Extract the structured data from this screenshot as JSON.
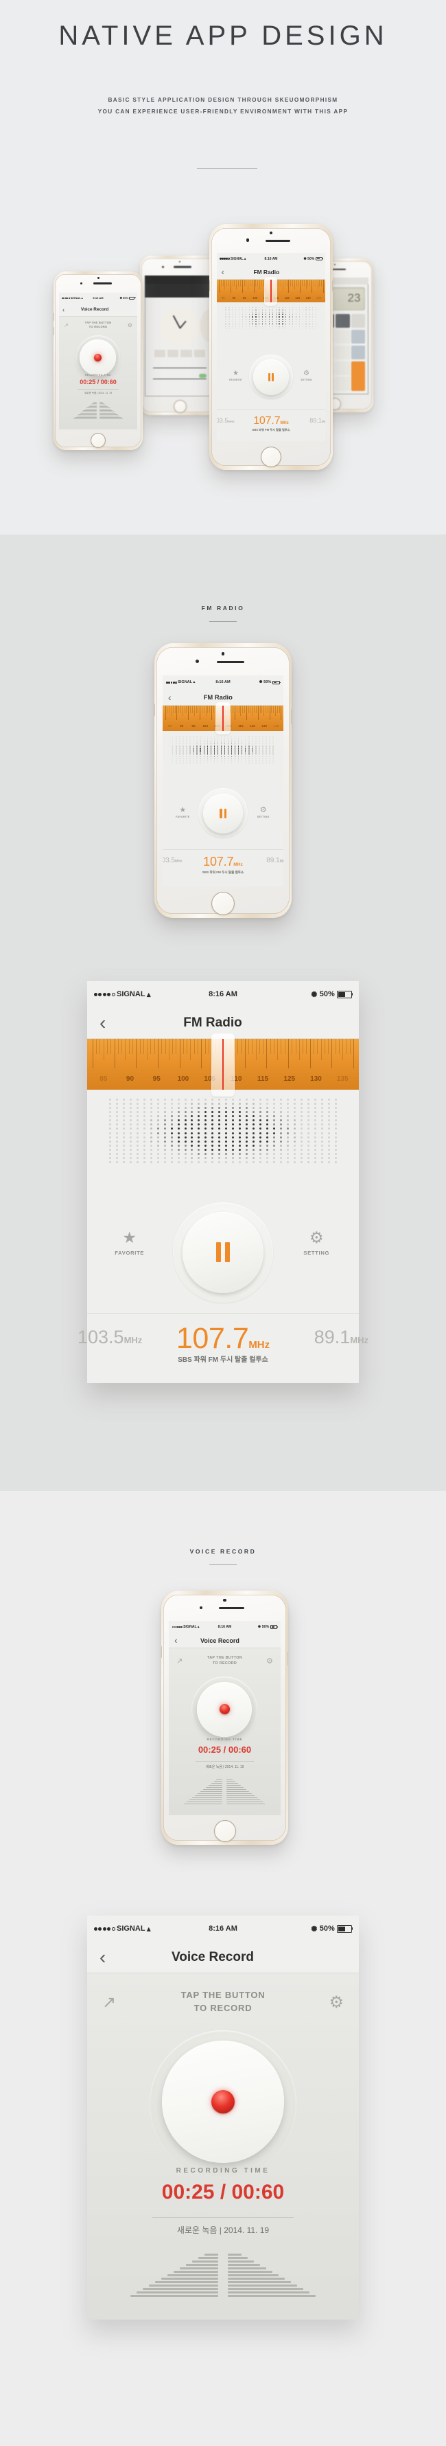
{
  "header": {
    "title": "NATIVE APP DESIGN",
    "subtitle_line1": "BASIC STYLE APPLICATION DESIGN THROUGH SKEUOMORPHISM",
    "subtitle_line2": "YOU CAN EXPERIENCE USER-FRIENDLY ENVIRONMENT WITH THIS APP"
  },
  "sections": {
    "fm_label": "FM RADIO",
    "voice_label": "VOICE RECORD"
  },
  "statusbar": {
    "carrier": "SIGNAL",
    "time": "8:16 AM",
    "battery": "50%",
    "wifi_icon": "wifi-icon",
    "bluetooth_icon": "bluetooth-icon",
    "battery_icon": "battery-icon",
    "signal_dots_icon": "signal-dots-icon"
  },
  "fm_radio": {
    "nav": {
      "title": "FM Radio",
      "back_icon": "back-chevron-icon",
      "menu_icon": "list-menu-icon"
    },
    "tuner": {
      "ticks": [
        "85",
        "90",
        "95",
        "100",
        "105",
        "110",
        "115",
        "125",
        "130",
        "135"
      ],
      "needle_value": "107.7",
      "needle_icon": "tuner-needle-icon"
    },
    "speaker_icon": "speaker-grille-icon",
    "play_button": {
      "icon": "pause-icon",
      "state": "playing"
    },
    "favorite": {
      "label": "FAVORITE",
      "icon": "star-icon"
    },
    "setting": {
      "label": "SETTING",
      "icon": "gear-icon"
    },
    "frequency": {
      "prev": "103.5",
      "prev_unit": "MHz",
      "current": "107.7",
      "current_unit": "MHz",
      "next": "89.1",
      "next_unit": "MHz"
    },
    "station_name": "SBS 파워 FM 두시 탈출 컬투쇼",
    "accent_color": "#ee8a29"
  },
  "voice_record": {
    "nav": {
      "title": "Voice Record",
      "back_icon": "back-chevron-icon",
      "menu_icon": "list-menu-icon"
    },
    "hint_line1": "TAP THE BUTTON",
    "hint_line2": "TO RECORD",
    "share_icon": "share-icon",
    "setting_icon": "gear-icon",
    "record_button_icon": "record-dot-icon",
    "recording_time_label": "RECORDING TIME",
    "recording_time_value": "00:25 / 00:60",
    "meta": "새로운 녹음  |  2014. 11. 19",
    "waveform_icon": "waveform-icon",
    "accent_color": "#d93a30"
  },
  "hero": {
    "phones": [
      {
        "name": "voice-record-phone",
        "app": "Voice Record"
      },
      {
        "name": "clock-phone",
        "app": "Clock"
      },
      {
        "name": "fm-radio-phone",
        "app": "FM Radio"
      },
      {
        "name": "calculator-phone",
        "app": "Calculator"
      }
    ]
  }
}
